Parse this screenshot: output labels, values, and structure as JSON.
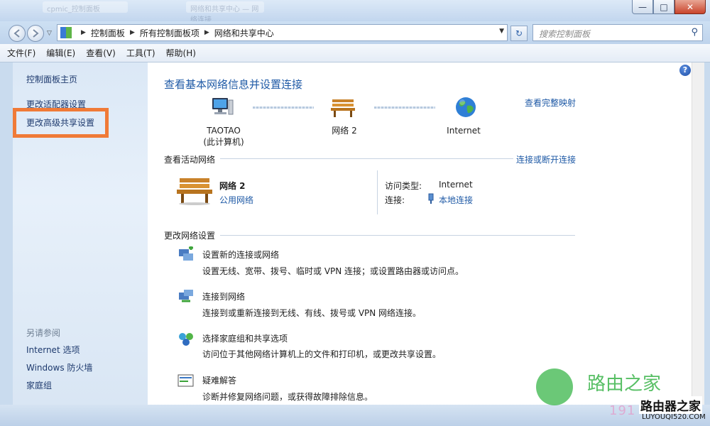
{
  "window": {
    "ghost_tabs": [
      "cpmic_控制面板",
      "网络和共享中心 — 网络连接"
    ]
  },
  "window_controls": {
    "minimize": "—",
    "maximize": "□",
    "close": "✕"
  },
  "address_bar": {
    "breadcrumb": [
      "控制面板",
      "所有控制面板项",
      "网络和共享中心"
    ],
    "refresh_label": "↻",
    "search_placeholder": "搜索控制面板"
  },
  "menu": [
    "文件(F)",
    "编辑(E)",
    "查看(V)",
    "工具(T)",
    "帮助(H)"
  ],
  "sidebar": {
    "items": [
      "控制面板主页",
      "更改适配器设置",
      "更改高级共享设置"
    ],
    "see_also_heading": "另请参阅",
    "see_also": [
      "Internet 选项",
      "Windows 防火墙",
      "家庭组"
    ]
  },
  "main": {
    "title": "查看基本网络信息并设置连接",
    "full_map_link": "查看完整映射",
    "nodes": [
      {
        "label": "TAOTAO",
        "sublabel": "(此计算机)",
        "icon": "computer-icon"
      },
      {
        "label": "网络  2",
        "icon": "bench-icon"
      },
      {
        "label": "Internet",
        "icon": "globe-icon"
      }
    ],
    "active_networks": {
      "heading": "查看活动网络",
      "connect_link": "连接或断开连接",
      "network_name": "网络  2",
      "network_type": "公用网络",
      "access_type_label": "访问类型:",
      "access_type_value": "Internet",
      "connections_label": "连接:",
      "connections_value": "本地连接"
    },
    "change_settings": {
      "heading": "更改网络设置",
      "actions": [
        {
          "title": "设置新的连接或网络",
          "desc": "设置无线、宽带、拨号、临时或 VPN 连接；或设置路由器或访问点。",
          "icon": "new-connection-icon"
        },
        {
          "title": "连接到网络",
          "desc": "连接到或重新连接到无线、有线、拨号或 VPN 网络连接。",
          "icon": "connect-network-icon"
        },
        {
          "title": "选择家庭组和共享选项",
          "desc": "访问位于其他网络计算机上的文件和打印机，或更改共享设置。",
          "icon": "homegroup-icon"
        },
        {
          "title": "疑难解答",
          "desc": "诊断并修复网络问题，或获得故障排除信息。",
          "icon": "troubleshoot-icon"
        }
      ]
    }
  },
  "watermark": {
    "text": "路由之家",
    "number": "191",
    "brand": "路由器之家",
    "url": "LUYOUQI520.COM"
  },
  "colors": {
    "link": "#1f5aa6",
    "highlight": "#f07a37",
    "sidebar_bg": "#dbe8f6"
  }
}
